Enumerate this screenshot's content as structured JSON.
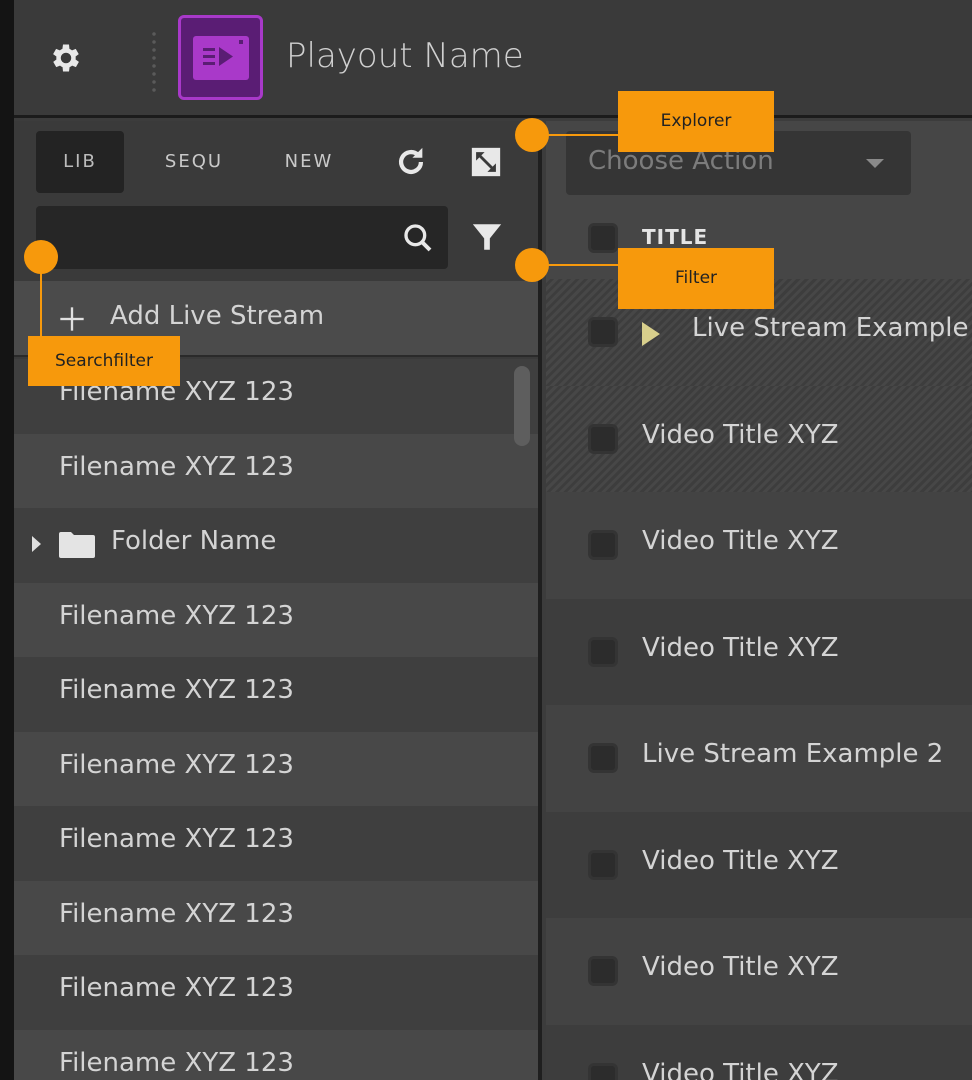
{
  "header": {
    "title": "Playout Name"
  },
  "left_panel": {
    "tabs": [
      {
        "label": "LIB",
        "active": true
      },
      {
        "label": "SEQU",
        "active": false
      },
      {
        "label": "NEW",
        "active": false
      }
    ],
    "search": {
      "placeholder": "",
      "value": ""
    },
    "add_live_label": "Add Live Stream",
    "files": [
      {
        "label": "Filename XYZ 123"
      },
      {
        "label": "Filename XYZ 123"
      },
      {
        "label": "Folder Name",
        "type": "folder"
      },
      {
        "label": "Filename XYZ 123"
      },
      {
        "label": "Filename XYZ 123"
      },
      {
        "label": "Filename XYZ 123"
      },
      {
        "label": "Filename XYZ 123"
      },
      {
        "label": "Filename XYZ 123"
      },
      {
        "label": "Filename XYZ 123"
      },
      {
        "label": "Filename XYZ 123"
      }
    ]
  },
  "right_panel": {
    "action_select": {
      "placeholder": "Choose Action"
    },
    "column_title": "TITLE",
    "rows": [
      {
        "label": "Live Stream Example",
        "live": true
      },
      {
        "label": "Video Title XYZ"
      },
      {
        "label": "Video Title XYZ"
      },
      {
        "label": "Video Title XYZ"
      },
      {
        "label": "Live Stream Example 2"
      },
      {
        "label": "Video Title XYZ"
      },
      {
        "label": "Video Title XYZ"
      },
      {
        "label": "Video Title XYZ"
      }
    ]
  },
  "callouts": {
    "explorer": "Explorer",
    "filter": "Filter",
    "searchfilter": "Searchfilter"
  },
  "colors": {
    "accent_callout": "#f7990c",
    "app_logo": "#a839c9",
    "live_play": "#d8cf8c"
  },
  "icons": [
    "gear-icon",
    "app-logo-icon",
    "refresh-icon",
    "expand-icon",
    "search-icon",
    "filter-icon",
    "plus-icon",
    "folder-icon",
    "caret-right-icon",
    "play-icon",
    "dropdown-caret-icon"
  ]
}
